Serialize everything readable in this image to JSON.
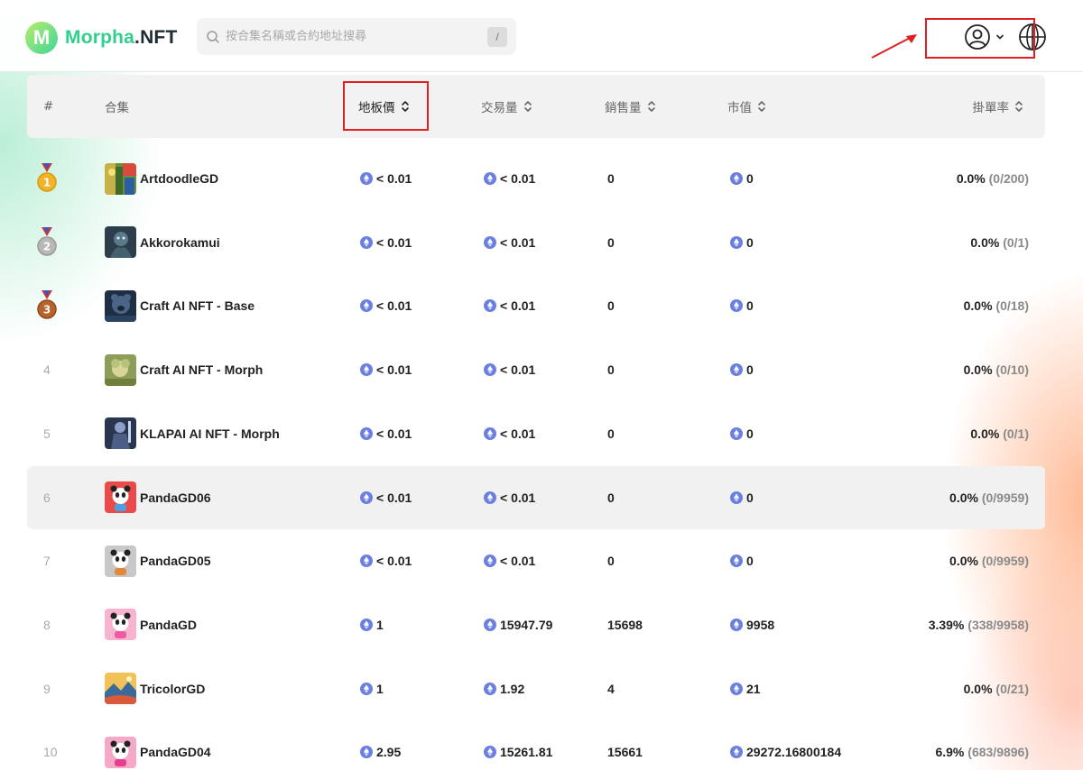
{
  "header": {
    "logo_letter": "M",
    "logo_text_main": "Morpha",
    "logo_text_suffix": ".NFT",
    "search_placeholder": "按合集名稱或合約地址搜尋",
    "search_shortcut": "/"
  },
  "colors": {
    "brand_green": "#2fcf8e",
    "annotation_red": "#e02020",
    "eth_badge": "#6b7fe0"
  },
  "table": {
    "columns": {
      "rank": "#",
      "collection": "合集",
      "floor_price": "地板價",
      "volume": "交易量",
      "sales": "銷售量",
      "market_cap": "市值",
      "listing_rate": "掛單率"
    },
    "rows": [
      {
        "rank": "1",
        "medal": "gold",
        "name": "ArtdoodleGD",
        "floor": "< 0.01",
        "volume": "< 0.01",
        "sales": "0",
        "mcap": "0",
        "rate": "0.0%",
        "ratio": "(0/200)",
        "thumb": "artdoodle"
      },
      {
        "rank": "2",
        "medal": "silver",
        "name": "Akkorokamui",
        "floor": "< 0.01",
        "volume": "< 0.01",
        "sales": "0",
        "mcap": "0",
        "rate": "0.0%",
        "ratio": "(0/1)",
        "thumb": "akkoro"
      },
      {
        "rank": "3",
        "medal": "bronze",
        "name": "Craft AI NFT - Base",
        "floor": "< 0.01",
        "volume": "< 0.01",
        "sales": "0",
        "mcap": "0",
        "rate": "0.0%",
        "ratio": "(0/18)",
        "thumb": "craftbase"
      },
      {
        "rank": "4",
        "medal": "",
        "name": "Craft AI NFT - Morph",
        "floor": "< 0.01",
        "volume": "< 0.01",
        "sales": "0",
        "mcap": "0",
        "rate": "0.0%",
        "ratio": "(0/10)",
        "thumb": "craftmorph"
      },
      {
        "rank": "5",
        "medal": "",
        "name": "KLAPAI AI NFT - Morph",
        "floor": "< 0.01",
        "volume": "< 0.01",
        "sales": "0",
        "mcap": "0",
        "rate": "0.0%",
        "ratio": "(0/1)",
        "thumb": "klapai"
      },
      {
        "rank": "6",
        "medal": "",
        "name": "PandaGD06",
        "floor": "< 0.01",
        "volume": "< 0.01",
        "sales": "0",
        "mcap": "0",
        "rate": "0.0%",
        "ratio": "(0/9959)",
        "thumb": "panda-red"
      },
      {
        "rank": "7",
        "medal": "",
        "name": "PandaGD05",
        "floor": "< 0.01",
        "volume": "< 0.01",
        "sales": "0",
        "mcap": "0",
        "rate": "0.0%",
        "ratio": "(0/9959)",
        "thumb": "panda-grey"
      },
      {
        "rank": "8",
        "medal": "",
        "name": "PandaGD",
        "floor": "1",
        "volume": "15947.79",
        "sales": "15698",
        "mcap": "9958",
        "rate": "3.39%",
        "ratio": "(338/9958)",
        "thumb": "panda-pink"
      },
      {
        "rank": "9",
        "medal": "",
        "name": "TricolorGD",
        "floor": "1",
        "volume": "1.92",
        "sales": "4",
        "mcap": "21",
        "rate": "0.0%",
        "ratio": "(0/21)",
        "thumb": "tricolor"
      },
      {
        "rank": "10",
        "medal": "",
        "name": "PandaGD04",
        "floor": "2.95",
        "volume": "15261.81",
        "sales": "15661",
        "mcap": "29272.16800184",
        "rate": "6.9%",
        "ratio": "(683/9896)",
        "thumb": "panda-pink2"
      }
    ]
  }
}
